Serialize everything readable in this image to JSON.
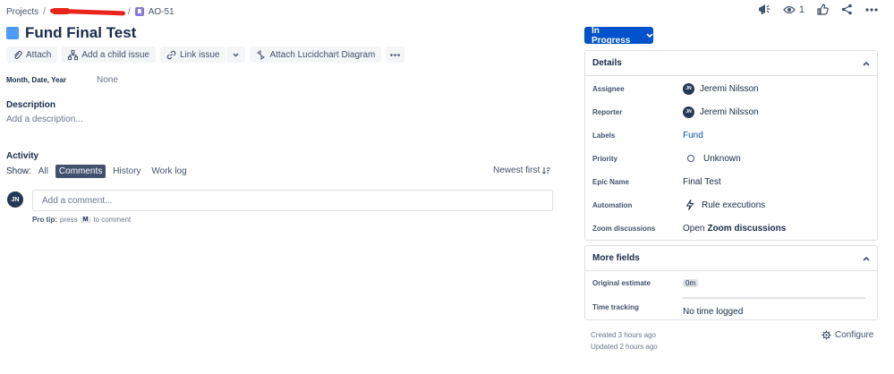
{
  "breadcrumb": {
    "projects": "Projects",
    "separator": "/",
    "issue_key": "AO-51"
  },
  "top_actions": {
    "watch_count": "1"
  },
  "issue": {
    "title": "Fund Final Test"
  },
  "toolbar": {
    "attach": "Attach",
    "add_child": "Add a child issue",
    "link_issue": "Link issue",
    "attach_lucid": "Attach Lucidchart Diagram"
  },
  "fields": {
    "date_label": "Month, Date, Year",
    "date_value": "None"
  },
  "description": {
    "heading": "Description",
    "placeholder": "Add a description..."
  },
  "activity": {
    "heading": "Activity",
    "show_label": "Show:",
    "filters": [
      "All",
      "Comments",
      "History",
      "Work log"
    ],
    "sort_label": "Newest first",
    "comment_placeholder": "Add a comment...",
    "protip_label": "Pro tip:",
    "protip_press": "press",
    "protip_key": "M",
    "protip_rest": "to comment",
    "avatar_initials": "JN"
  },
  "status": {
    "label": "In Progress"
  },
  "details": {
    "heading": "Details",
    "rows": [
      {
        "label": "Assignee",
        "value": "Jeremi Nilsson",
        "initials": "JN"
      },
      {
        "label": "Reporter",
        "value": "Jeremi Nilsson",
        "initials": "JN"
      },
      {
        "label": "Labels",
        "value": "Fund"
      },
      {
        "label": "Priority",
        "value": "Unknown"
      },
      {
        "label": "Epic Name",
        "value": "Final Test"
      },
      {
        "label": "Automation",
        "value": "Rule executions"
      },
      {
        "label": "Zoom discussions",
        "value_prefix": "Open",
        "value": "Zoom discussions"
      }
    ]
  },
  "more_fields": {
    "heading": "More fields",
    "rows": [
      {
        "label": "Original estimate",
        "value": "0m"
      },
      {
        "label": "Time tracking",
        "value": "No time logged"
      }
    ]
  },
  "meta": {
    "created": "Created 3 hours ago",
    "updated": "Updated 2 hours ago",
    "configure": "Configure"
  },
  "colors": {
    "primary": "#0052cc",
    "text": "#172b4d",
    "subtle": "#6b778c",
    "avatar": "#253858",
    "redaction": "#e8241b"
  }
}
